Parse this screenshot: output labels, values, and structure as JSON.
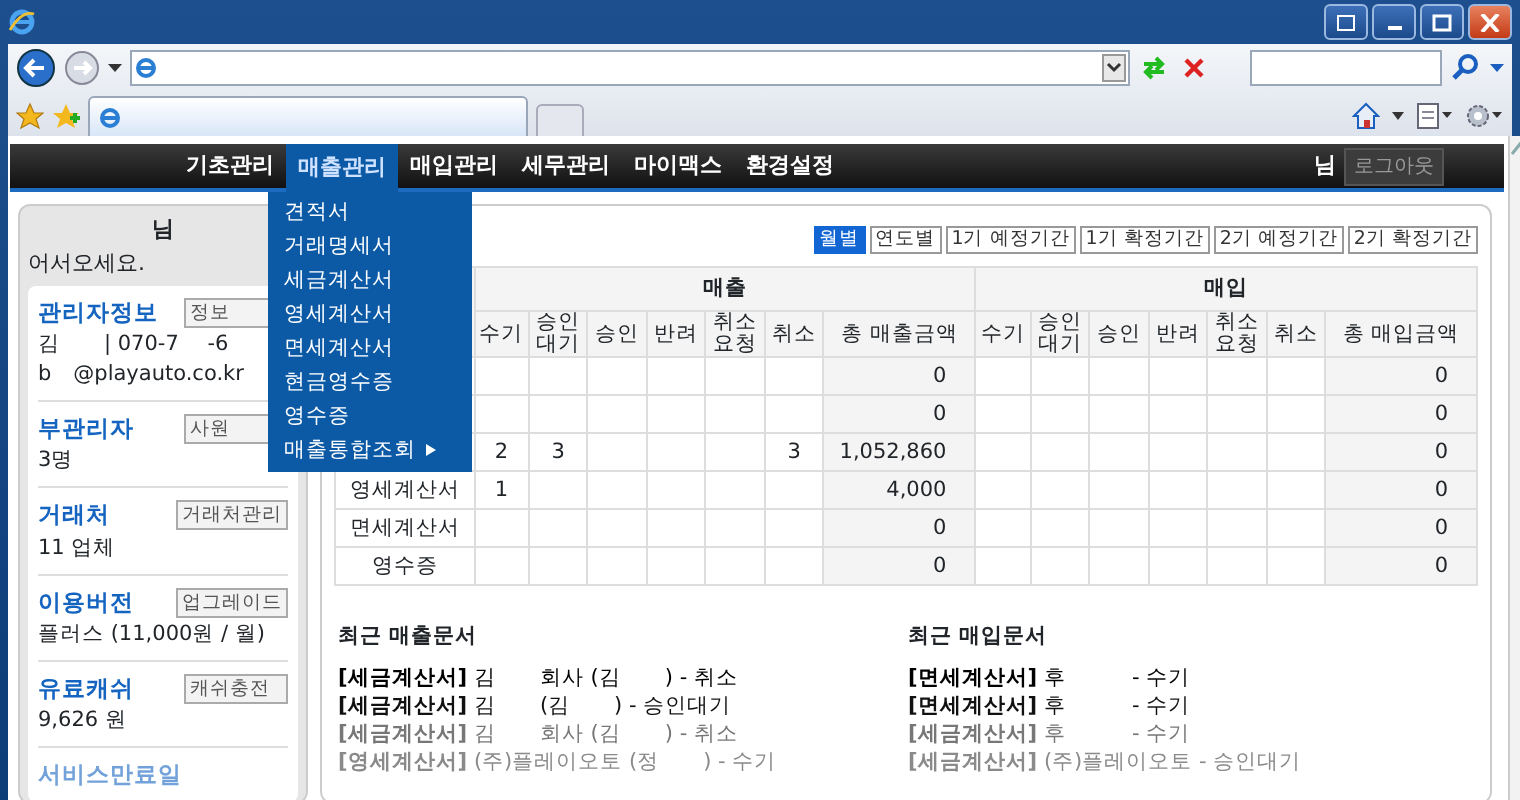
{
  "menu": {
    "items": [
      {
        "label": "기초관리",
        "selected": false
      },
      {
        "label": "매출관리",
        "selected": true
      },
      {
        "label": "매입관리",
        "selected": false
      },
      {
        "label": "세무관리",
        "selected": false
      },
      {
        "label": "마이맥스",
        "selected": false
      },
      {
        "label": "환경설정",
        "selected": false
      }
    ],
    "user_suffix": "님",
    "logout": "로그아웃"
  },
  "dropdown": [
    {
      "label": "견적서"
    },
    {
      "label": "거래명세서"
    },
    {
      "label": "세금계산서"
    },
    {
      "label": "영세계산서"
    },
    {
      "label": "면세계산서"
    },
    {
      "label": "현금영수증"
    },
    {
      "label": "영수증"
    },
    {
      "label": "매출통합조회",
      "submenu": true
    }
  ],
  "sidebar": {
    "name_suffix": "님",
    "greeting": "어서오세요.",
    "sections": [
      {
        "title": "관리자정보",
        "button": "정보",
        "lines": [
          "김　　| 070-7　 -6",
          "b　@playauto.co.kr"
        ]
      },
      {
        "title": "부관리자",
        "button": "사원",
        "lines": [
          "3명"
        ]
      },
      {
        "title": "거래처",
        "button": "거래처관리",
        "lines": [
          "11 업체"
        ]
      },
      {
        "title": "이용버전",
        "button": "업그레이드",
        "lines": [
          "플러스 (11,000원 / 월)"
        ]
      },
      {
        "title": "유료캐쉬",
        "button": "캐쉬충전",
        "lines": [
          "9,626 원"
        ]
      },
      {
        "title": "서비스만료일"
      }
    ]
  },
  "periods": [
    {
      "label": "월별",
      "selected": true
    },
    {
      "label": "연도별",
      "selected": false
    },
    {
      "label": "1기 예정기간",
      "selected": false
    },
    {
      "label": "1기 확정기간",
      "selected": false
    },
    {
      "label": "2기 예정기간",
      "selected": false
    },
    {
      "label": "2기 확정기간",
      "selected": false
    }
  ],
  "table": {
    "groups": [
      "매출",
      "매입"
    ],
    "columns": [
      "수기",
      "승인대기",
      "승인",
      "반려",
      "취소요청",
      "취소",
      "총 매출금액",
      "수기",
      "승인대기",
      "승인",
      "반려",
      "취소요청",
      "취소",
      "총 매입금액"
    ],
    "rows": [
      {
        "sales": {
          "total": "0"
        },
        "purchase": {
          "total": "0"
        }
      },
      {
        "sales": {
          "total": "0"
        },
        "purchase": {
          "total": "0"
        }
      },
      {
        "sales": {
          "manual": "2",
          "pending_approval": "3",
          "cancelled": "3",
          "total": "1,052,860"
        },
        "purchase": {
          "total": "0"
        }
      },
      {
        "label": "영세계산서",
        "sales": {
          "manual": "1",
          "total": "4,000"
        },
        "purchase": {
          "total": "0"
        }
      },
      {
        "label": "면세계산서",
        "sales": {
          "total": "0"
        },
        "purchase": {
          "total": "0"
        }
      },
      {
        "label": "영수증",
        "sales": {
          "total": "0"
        },
        "purchase": {
          "total": "0"
        }
      }
    ]
  },
  "recent": [
    {
      "title": "최근 매출문서",
      "items": [
        "**[세금계산서]** 김　　회사 (김　　) - 취소",
        "**[세금계산서]** 김　　(김　　) - 승인대기",
        "**[세금계산서]** 김　　회사 (김　　) - 취소",
        "**[영세계산서]** (주)플레이오토 (정　　) - 수기"
      ]
    },
    {
      "title": "최근 매입문서",
      "items": [
        "**[면세계산서]** 후　　　- 수기",
        "**[면세계산서]** 후　　　- 수기",
        "**[세금계산서]** 후　　　- 수기",
        "**[세금계산서]** (주)플레이오토 - 승인대기"
      ]
    }
  ]
}
